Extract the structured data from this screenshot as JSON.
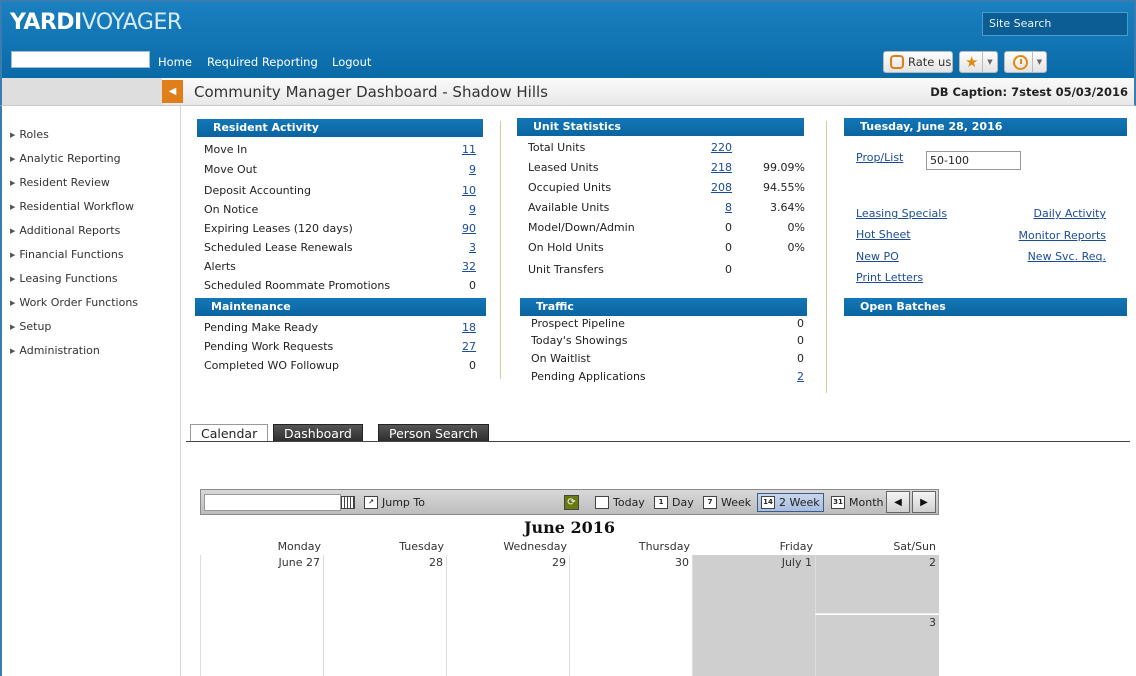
{
  "header": {
    "logo_bold": "YARDI",
    "logo_light": "VOYAGER",
    "site_search": "Site Search",
    "nav": [
      "Home",
      "Required Reporting",
      "Logout"
    ],
    "rate_label": "Rate us"
  },
  "titlebar": {
    "title": "Community Manager Dashboard - Shadow Hills",
    "db_caption": "DB Caption: 7stest 05/03/2016"
  },
  "sidebar": {
    "items": [
      "Roles",
      "Analytic Reporting",
      "Resident Review",
      "Residential Workflow",
      "Additional Reports",
      "Financial Functions",
      "Leasing Functions",
      "Work Order Functions",
      "Setup",
      "Administration"
    ]
  },
  "resident_activity": {
    "title": "Resident Activity",
    "rows": [
      {
        "label": "Move In",
        "value": "11"
      },
      {
        "label": "Move Out",
        "value": "9"
      },
      {
        "label": "Deposit Accounting",
        "value": "10"
      },
      {
        "label": "On Notice",
        "value": "9"
      },
      {
        "label": "Expiring Leases (120 days)",
        "value": "90"
      },
      {
        "label": "Scheduled Lease Renewals",
        "value": "3"
      },
      {
        "label": "Alerts",
        "value": "32"
      },
      {
        "label": "Scheduled Roommate Promotions",
        "value": "0"
      }
    ]
  },
  "maintenance": {
    "title": "Maintenance",
    "rows": [
      {
        "label": "Pending Make Ready",
        "value": "18"
      },
      {
        "label": "Pending Work Requests",
        "value": "27"
      },
      {
        "label": "Completed WO Followup",
        "value": "0"
      }
    ]
  },
  "unit_statistics": {
    "title": "Unit Statistics",
    "rows": [
      {
        "label": "Total Units",
        "value": "220",
        "pct": ""
      },
      {
        "label": "Leased Units",
        "value": "218",
        "pct": "99.09%"
      },
      {
        "label": "Occupied Units",
        "value": "208",
        "pct": "94.55%"
      },
      {
        "label": "Available Units",
        "value": "8",
        "pct": "3.64%"
      },
      {
        "label": "Model/Down/Admin",
        "value": "0",
        "pct": "0%"
      },
      {
        "label": "On Hold Units",
        "value": "0",
        "pct": "0%"
      },
      {
        "label": "Unit Transfers",
        "value": "0",
        "pct": ""
      }
    ]
  },
  "traffic": {
    "title": "Traffic",
    "rows": [
      {
        "label": "Prospect Pipeline",
        "value": "0"
      },
      {
        "label": "Today's Showings",
        "value": "0"
      },
      {
        "label": "On Waitlist",
        "value": "0"
      },
      {
        "label": "Pending Applications",
        "value": "2"
      }
    ]
  },
  "right_panel": {
    "date_header": "Tuesday, June 28, 2016",
    "prop_label": "Prop/List",
    "prop_value": "50-100",
    "links_left": [
      "Leasing Specials",
      "Hot Sheet",
      "New PO",
      "Print Letters"
    ],
    "links_right": [
      "Daily Activity",
      "Monitor Reports",
      "New Svc. Req."
    ],
    "open_batches": "Open Batches"
  },
  "tabs": [
    "Calendar",
    "Dashboard",
    "Person Search"
  ],
  "calendar": {
    "jump_to": "Jump To",
    "views": [
      "Today",
      "Day",
      "Week",
      "2 Week",
      "Month"
    ],
    "view_icons": [
      "",
      "1",
      "7",
      "14",
      "31"
    ],
    "selected_view": "2 Week",
    "title": "June 2016",
    "days": [
      "Monday",
      "Tuesday",
      "Wednesday",
      "Thursday",
      "Friday",
      "Sat/Sun"
    ],
    "dates": [
      "June 27",
      "28",
      "29",
      "30",
      "July 1",
      "2"
    ],
    "sunday_date": "3"
  }
}
